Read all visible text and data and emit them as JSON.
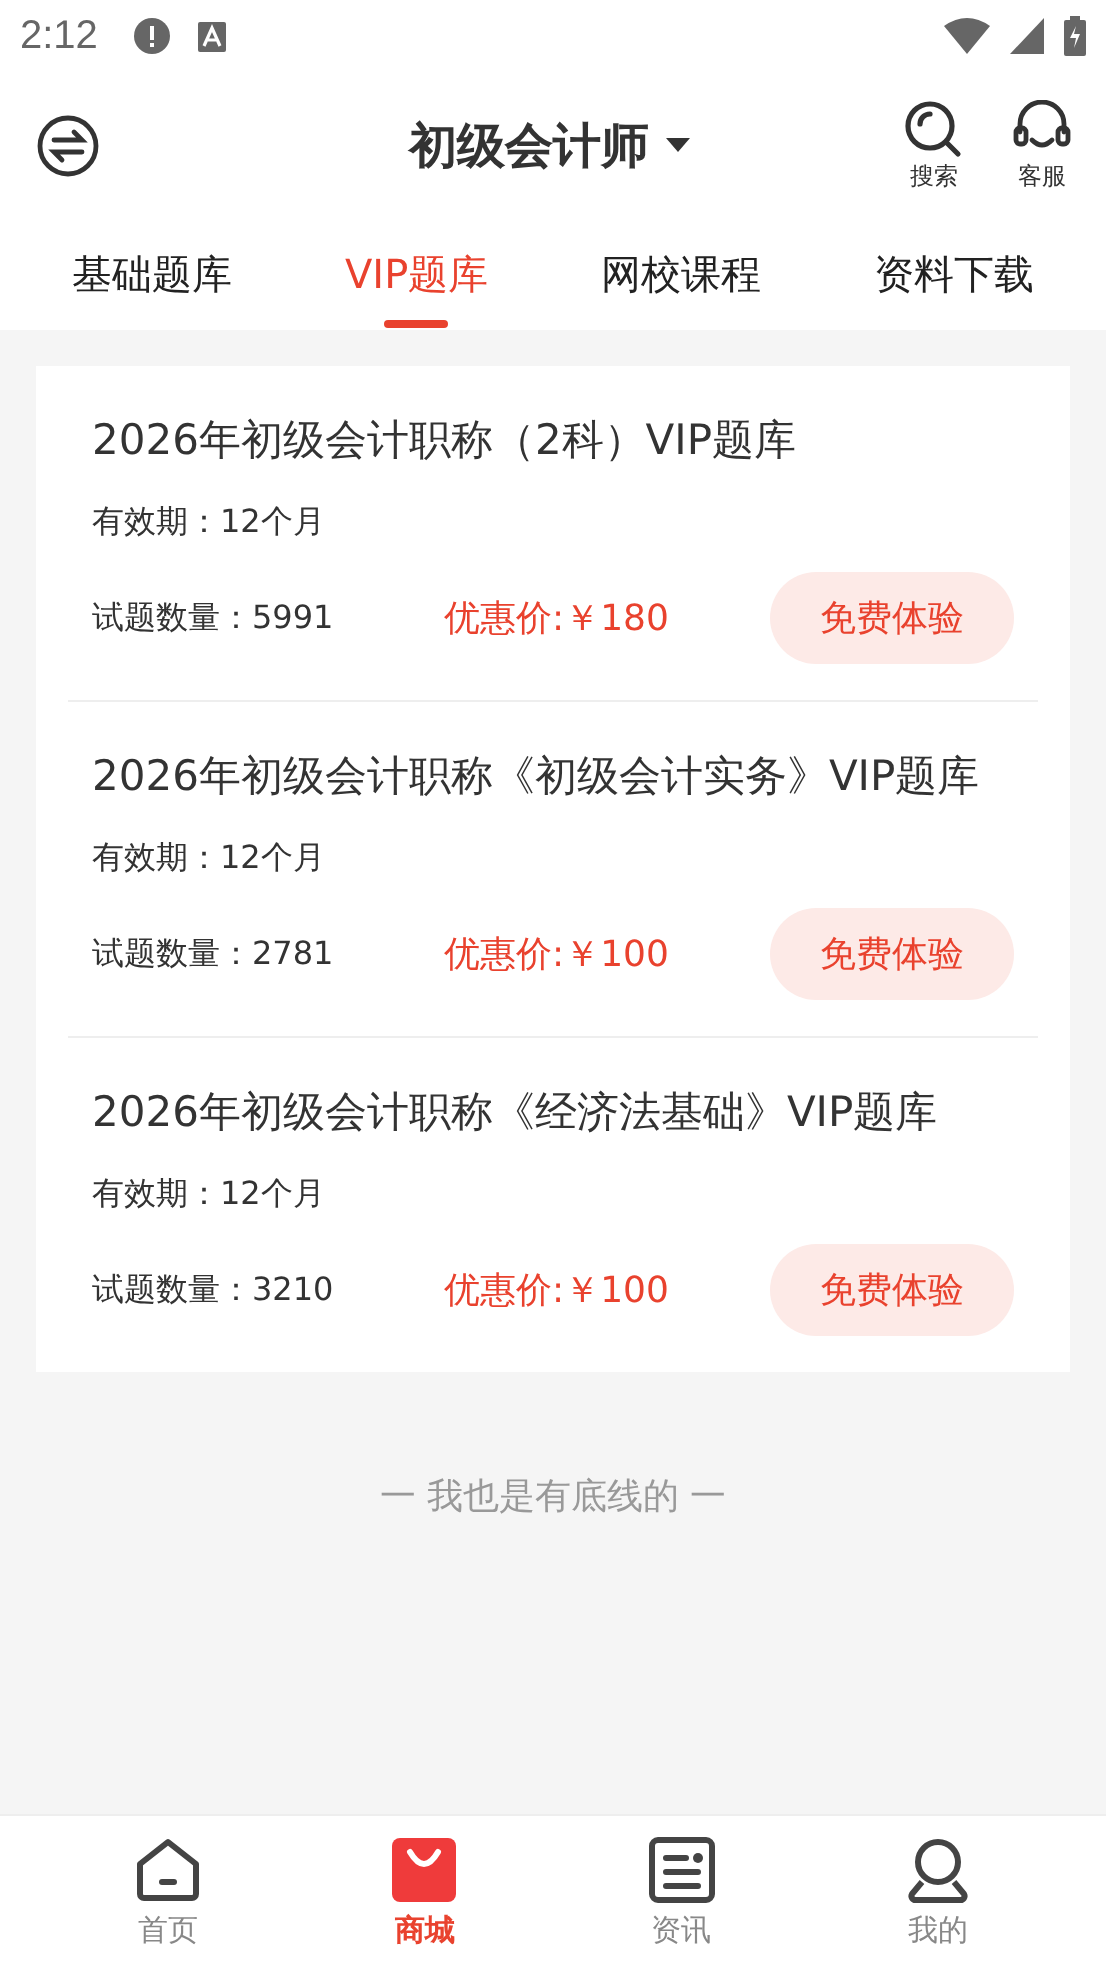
{
  "status_bar": {
    "time": "2:12"
  },
  "header": {
    "title": "初级会计师",
    "actions": [
      {
        "kind": "search",
        "label": "搜索"
      },
      {
        "kind": "service",
        "label": "客服"
      }
    ]
  },
  "tabs": [
    {
      "label": "基础题库",
      "selected": false
    },
    {
      "label": "VIP题库",
      "selected": true
    },
    {
      "label": "网校课程",
      "selected": false
    },
    {
      "label": "资料下载",
      "selected": false
    }
  ],
  "products": [
    {
      "title": "2026年初级会计职称（2科）VIP题库",
      "validity": "有效期：12个月",
      "count": "试题数量：5991",
      "price": "优惠价:￥180",
      "button": "免费体验"
    },
    {
      "title": "2026年初级会计职称《初级会计实务》VIP题库",
      "validity": "有效期：12个月",
      "count": "试题数量：2781",
      "price": "优惠价:￥100",
      "button": "免费体验"
    },
    {
      "title": "2026年初级会计职称《经济法基础》VIP题库",
      "validity": "有效期：12个月",
      "count": "试题数量：3210",
      "price": "优惠价:￥100",
      "button": "免费体验"
    }
  ],
  "end_note": "一  我也是有底线的  一",
  "bottom_nav": [
    {
      "kind": "home",
      "label": "首页",
      "selected": false
    },
    {
      "kind": "shop",
      "label": "商城",
      "selected": true
    },
    {
      "kind": "news",
      "label": "资讯",
      "selected": false
    },
    {
      "kind": "profile",
      "label": "我的",
      "selected": false
    }
  ]
}
